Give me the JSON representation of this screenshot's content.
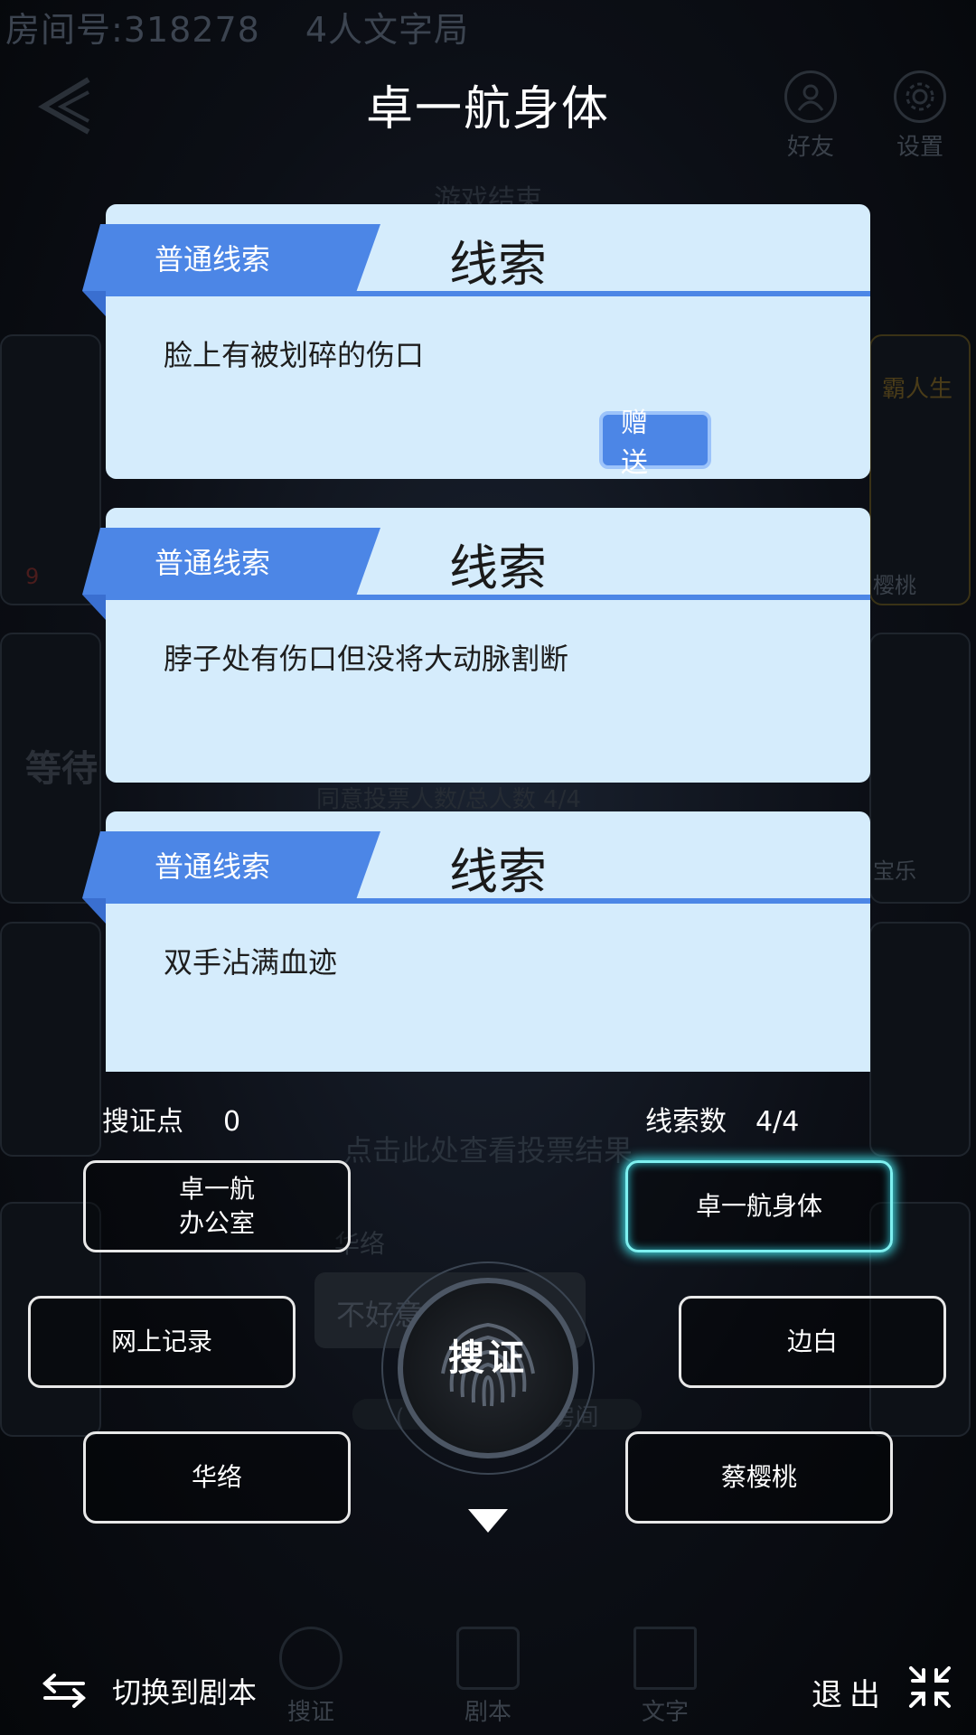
{
  "background": {
    "room_number": "房间号:318278",
    "room_mode": "4人文字局",
    "friends_label": "好友",
    "settings_label": "设置",
    "game_status": "游戏结束",
    "waiting_text": "等待",
    "vote_count_text": "同意投票人数/总人数 4/4",
    "vote_result_link": "点击此处查看投票结果",
    "side_label_left": "9",
    "side_label_right_1": "樱桃",
    "side_label_right_2": "宝乐",
    "banner_text": "霸人生",
    "chat_name": "华络",
    "chat_message": "不好意",
    "chat_notice": "(˚O80) 进入了房间",
    "nav": {
      "search": "搜证",
      "script": "剧本",
      "text": "文字"
    }
  },
  "overlay": {
    "title": "卓一航身体",
    "clues": [
      {
        "tag": "普通线索",
        "heading": "线索",
        "text": "脸上有被划碎的伤口",
        "gift_label": "赠 送"
      },
      {
        "tag": "普通线索",
        "heading": "线索",
        "text": "脖子处有伤口但没将大动脉割断"
      },
      {
        "tag": "普通线索",
        "heading": "线索",
        "text": "双手沾满血迹"
      }
    ],
    "stats": {
      "evidence_label": "搜证点",
      "evidence_value": "0",
      "clue_label": "线索数",
      "clue_value": "4/4"
    },
    "locations": {
      "office_line1": "卓一航",
      "office_line2": "办公室",
      "body": "卓一航身体",
      "online": "网上记录",
      "bianbai": "边白",
      "hualuo": "华络",
      "cai": "蔡樱桃"
    },
    "search_button": "搜证",
    "switch_label": "切换到剧本",
    "exit_label": "退出"
  },
  "colors": {
    "card_bg": "#d5ecfc",
    "accent_blue": "#4c86e6",
    "active_glow": "#3fd4dc"
  }
}
